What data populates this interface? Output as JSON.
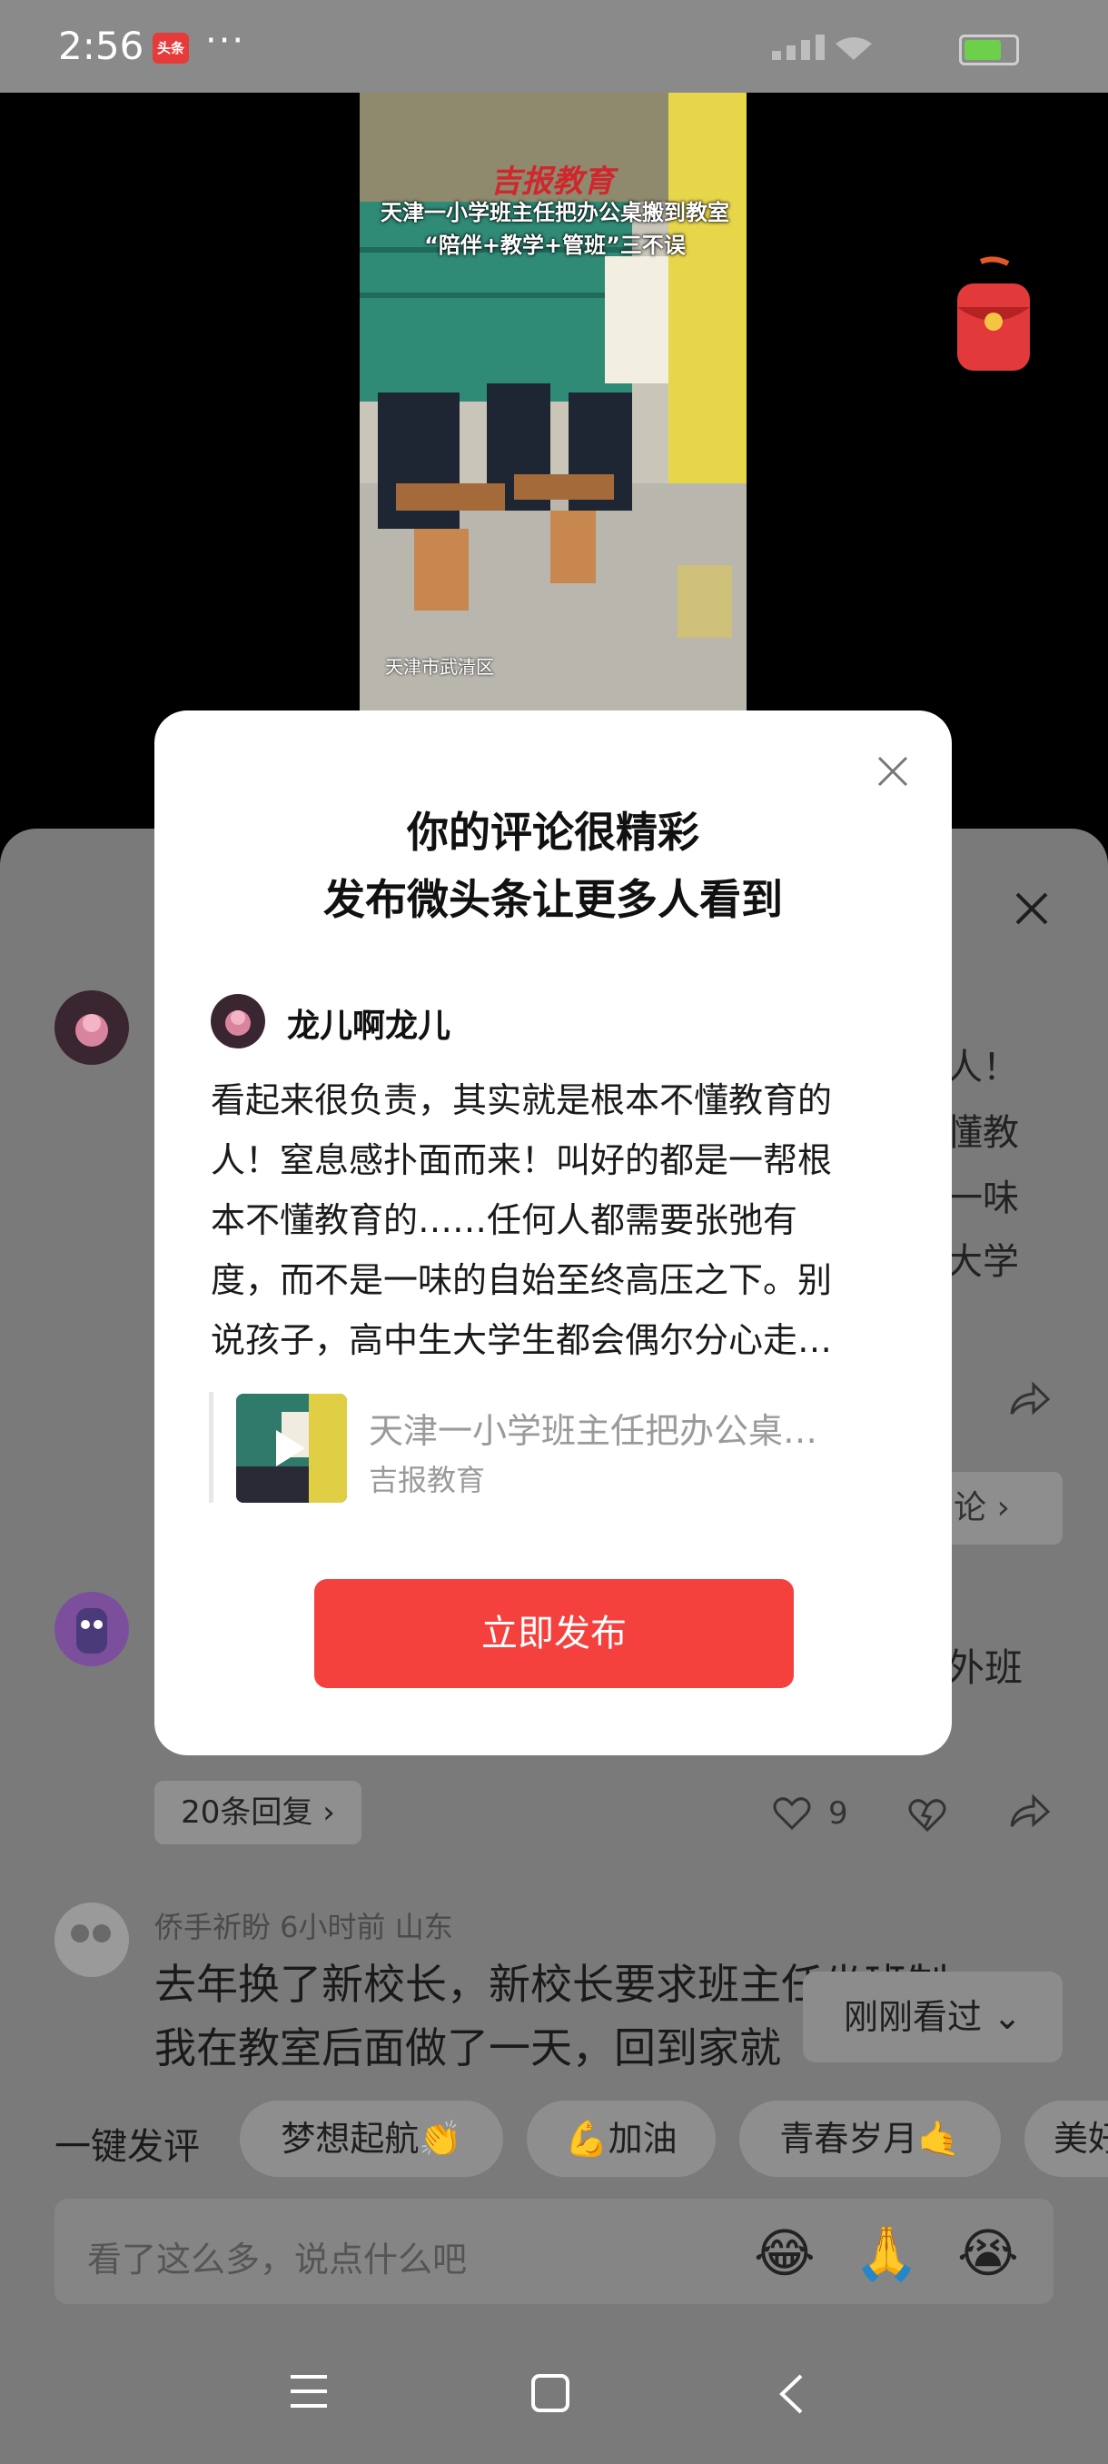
{
  "status_bar": {
    "time": "2:56",
    "app_badge": "头条",
    "more": "···"
  },
  "video": {
    "logo": "吉报教育",
    "title_line1": "天津一小学班主任把办公桌搬到教室",
    "title_line2": "“陪伴+教学+管班”三不误",
    "location": "天津市武清区"
  },
  "dialog": {
    "title_line1": "你的评论很精彩",
    "title_line2": "发布微头条让更多人看到",
    "username": "龙儿啊龙儿",
    "comment_lines": [
      "看起来很负责，其实就是根本不懂教育的",
      "人！窒息感扑面而来！叫好的都是一帮根",
      "本不懂教育的……任何人都需要张弛有",
      "度，而不是一味的自始至终高压之下。别",
      "说孩子，高中生大学生都会偶尔分心走…"
    ],
    "article_title": "天津一小学班主任把办公桌…",
    "article_source": "吉报教育",
    "publish_button": "立即发布"
  },
  "comments_sheet": {
    "fragments": [
      "人！",
      "懂教",
      "一味",
      "大学"
    ],
    "reply_more": "论 ›",
    "fragment_class": "外班",
    "replies_button": "20条回复 ›",
    "like_count": "9",
    "comment3": {
      "meta": "侨手祈盼  6小时前  山东",
      "line1": "去年换了新校长，新校长要求班主任坐班制",
      "line2": "我在教室后面做了一天，回到家就"
    },
    "seen_badge": "刚刚看过 ⌄"
  },
  "quick_comment": {
    "label": "一键发评",
    "chips": [
      "梦想起航👏",
      "💪加油",
      "青春岁月🤙",
      "美好"
    ]
  },
  "input": {
    "placeholder": "看了这么多，说点什么吧",
    "emojis": [
      "😂",
      "🙏",
      "😭"
    ]
  }
}
